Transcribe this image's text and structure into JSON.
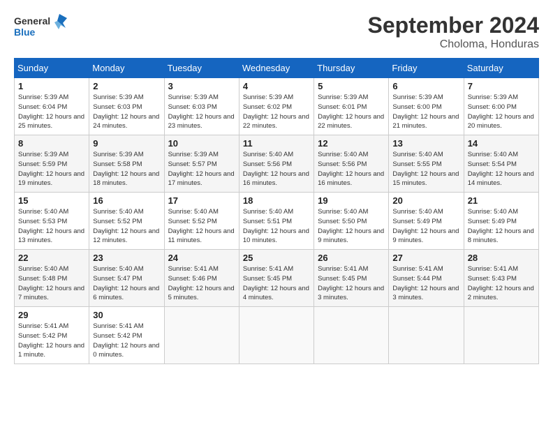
{
  "header": {
    "logo_line1": "General",
    "logo_line2": "Blue",
    "month": "September 2024",
    "location": "Choloma, Honduras"
  },
  "weekdays": [
    "Sunday",
    "Monday",
    "Tuesday",
    "Wednesday",
    "Thursday",
    "Friday",
    "Saturday"
  ],
  "weeks": [
    [
      {
        "day": "1",
        "info": "Sunrise: 5:39 AM\nSunset: 6:04 PM\nDaylight: 12 hours\nand 25 minutes."
      },
      {
        "day": "2",
        "info": "Sunrise: 5:39 AM\nSunset: 6:03 PM\nDaylight: 12 hours\nand 24 minutes."
      },
      {
        "day": "3",
        "info": "Sunrise: 5:39 AM\nSunset: 6:03 PM\nDaylight: 12 hours\nand 23 minutes."
      },
      {
        "day": "4",
        "info": "Sunrise: 5:39 AM\nSunset: 6:02 PM\nDaylight: 12 hours\nand 22 minutes."
      },
      {
        "day": "5",
        "info": "Sunrise: 5:39 AM\nSunset: 6:01 PM\nDaylight: 12 hours\nand 22 minutes."
      },
      {
        "day": "6",
        "info": "Sunrise: 5:39 AM\nSunset: 6:00 PM\nDaylight: 12 hours\nand 21 minutes."
      },
      {
        "day": "7",
        "info": "Sunrise: 5:39 AM\nSunset: 6:00 PM\nDaylight: 12 hours\nand 20 minutes."
      }
    ],
    [
      {
        "day": "8",
        "info": "Sunrise: 5:39 AM\nSunset: 5:59 PM\nDaylight: 12 hours\nand 19 minutes."
      },
      {
        "day": "9",
        "info": "Sunrise: 5:39 AM\nSunset: 5:58 PM\nDaylight: 12 hours\nand 18 minutes."
      },
      {
        "day": "10",
        "info": "Sunrise: 5:39 AM\nSunset: 5:57 PM\nDaylight: 12 hours\nand 17 minutes."
      },
      {
        "day": "11",
        "info": "Sunrise: 5:40 AM\nSunset: 5:56 PM\nDaylight: 12 hours\nand 16 minutes."
      },
      {
        "day": "12",
        "info": "Sunrise: 5:40 AM\nSunset: 5:56 PM\nDaylight: 12 hours\nand 16 minutes."
      },
      {
        "day": "13",
        "info": "Sunrise: 5:40 AM\nSunset: 5:55 PM\nDaylight: 12 hours\nand 15 minutes."
      },
      {
        "day": "14",
        "info": "Sunrise: 5:40 AM\nSunset: 5:54 PM\nDaylight: 12 hours\nand 14 minutes."
      }
    ],
    [
      {
        "day": "15",
        "info": "Sunrise: 5:40 AM\nSunset: 5:53 PM\nDaylight: 12 hours\nand 13 minutes."
      },
      {
        "day": "16",
        "info": "Sunrise: 5:40 AM\nSunset: 5:52 PM\nDaylight: 12 hours\nand 12 minutes."
      },
      {
        "day": "17",
        "info": "Sunrise: 5:40 AM\nSunset: 5:52 PM\nDaylight: 12 hours\nand 11 minutes."
      },
      {
        "day": "18",
        "info": "Sunrise: 5:40 AM\nSunset: 5:51 PM\nDaylight: 12 hours\nand 10 minutes."
      },
      {
        "day": "19",
        "info": "Sunrise: 5:40 AM\nSunset: 5:50 PM\nDaylight: 12 hours\nand 9 minutes."
      },
      {
        "day": "20",
        "info": "Sunrise: 5:40 AM\nSunset: 5:49 PM\nDaylight: 12 hours\nand 9 minutes."
      },
      {
        "day": "21",
        "info": "Sunrise: 5:40 AM\nSunset: 5:49 PM\nDaylight: 12 hours\nand 8 minutes."
      }
    ],
    [
      {
        "day": "22",
        "info": "Sunrise: 5:40 AM\nSunset: 5:48 PM\nDaylight: 12 hours\nand 7 minutes."
      },
      {
        "day": "23",
        "info": "Sunrise: 5:40 AM\nSunset: 5:47 PM\nDaylight: 12 hours\nand 6 minutes."
      },
      {
        "day": "24",
        "info": "Sunrise: 5:41 AM\nSunset: 5:46 PM\nDaylight: 12 hours\nand 5 minutes."
      },
      {
        "day": "25",
        "info": "Sunrise: 5:41 AM\nSunset: 5:45 PM\nDaylight: 12 hours\nand 4 minutes."
      },
      {
        "day": "26",
        "info": "Sunrise: 5:41 AM\nSunset: 5:45 PM\nDaylight: 12 hours\nand 3 minutes."
      },
      {
        "day": "27",
        "info": "Sunrise: 5:41 AM\nSunset: 5:44 PM\nDaylight: 12 hours\nand 3 minutes."
      },
      {
        "day": "28",
        "info": "Sunrise: 5:41 AM\nSunset: 5:43 PM\nDaylight: 12 hours\nand 2 minutes."
      }
    ],
    [
      {
        "day": "29",
        "info": "Sunrise: 5:41 AM\nSunset: 5:42 PM\nDaylight: 12 hours\nand 1 minute."
      },
      {
        "day": "30",
        "info": "Sunrise: 5:41 AM\nSunset: 5:42 PM\nDaylight: 12 hours\nand 0 minutes."
      },
      {
        "day": "",
        "info": ""
      },
      {
        "day": "",
        "info": ""
      },
      {
        "day": "",
        "info": ""
      },
      {
        "day": "",
        "info": ""
      },
      {
        "day": "",
        "info": ""
      }
    ]
  ]
}
